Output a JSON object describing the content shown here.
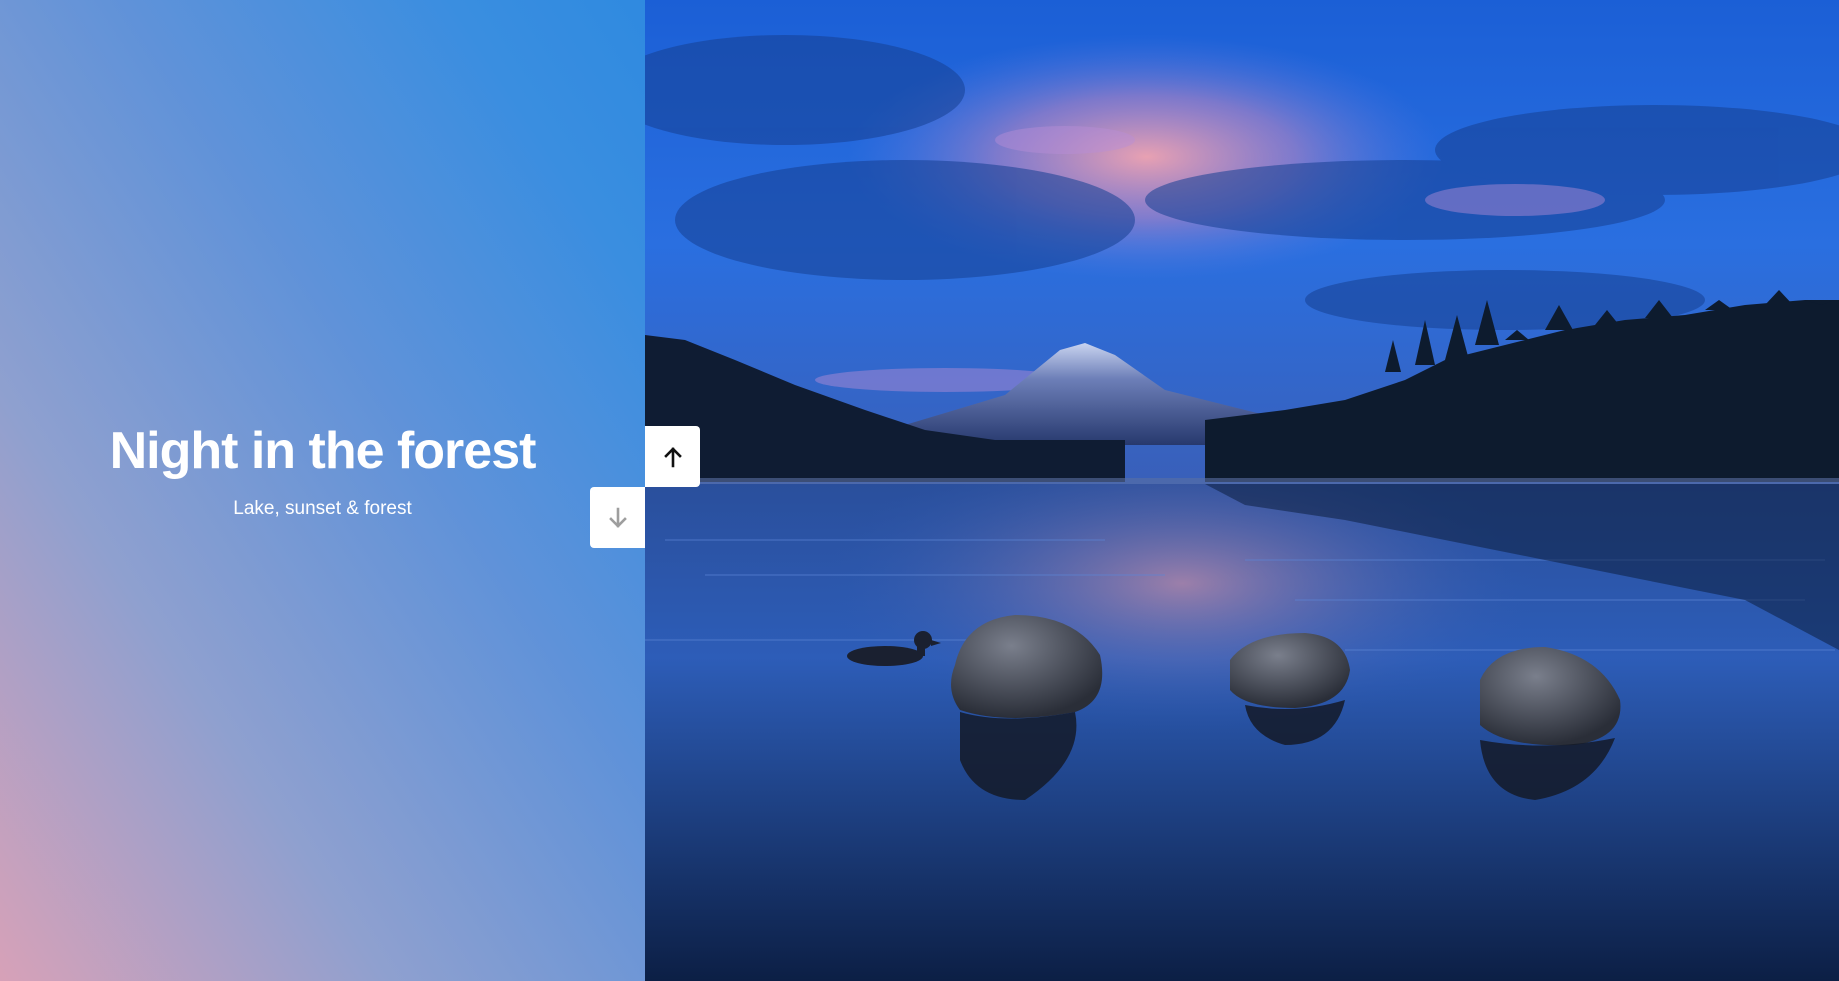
{
  "slide": {
    "title": "Night in the forest",
    "subtitle": "Lake, sunset & forest"
  },
  "navigation": {
    "up_icon": "arrow-up-icon",
    "down_icon": "arrow-down-icon",
    "up_color": "#111111",
    "down_color": "#9e9e9e"
  },
  "colors": {
    "gradient_top": "#2f8ae0",
    "gradient_bottom": "#d7a1b8",
    "photo_sky": "#1f6fe0",
    "photo_water": "#0f2a5c"
  }
}
